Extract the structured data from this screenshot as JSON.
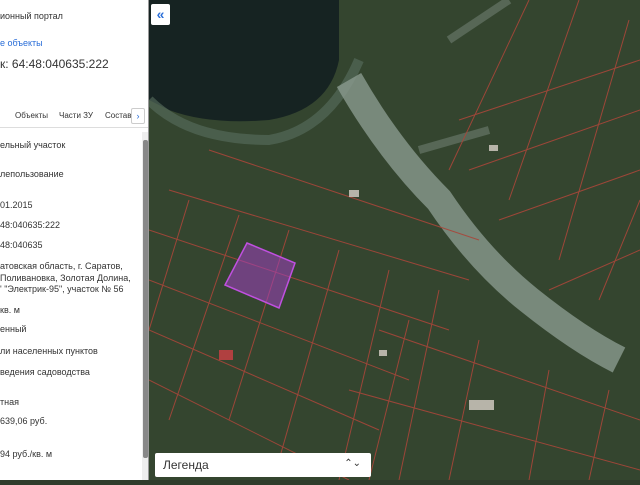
{
  "panel": {
    "portal_title": "ионный портал",
    "link": "е объекты",
    "cadastral_heading": "к: 64:48:040635:222",
    "tabs": [
      "Объекты",
      "Части ЗУ",
      "Состав"
    ],
    "tabs_next": "›",
    "fields": [
      "ельный участок",
      "лепользование",
      "01.2015",
      "48:040635:222",
      "48:040635",
      "атовская область, г. Саратов,",
      " Поливановка, Золотая Долина,",
      "' \"Электрик-95\", участок № 56",
      " кв. м",
      "енный",
      "ли населенных пунктов",
      " ведения садоводства",
      "тная",
      " 639,06 руб.",
      "94 руб./кв. м"
    ]
  },
  "map": {
    "collapse_icon": "«",
    "legend_label": "Легенда",
    "legend_arrow": "⌃⌄"
  },
  "colors": {
    "link": "#2a6ed8",
    "parcel_line": "#b0493a",
    "selected_parcel": "#a040c0"
  }
}
